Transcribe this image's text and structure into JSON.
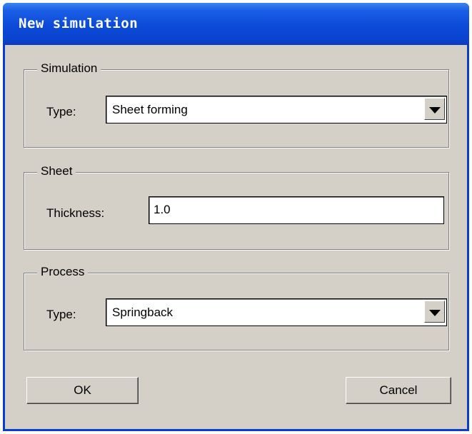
{
  "dialog": {
    "title": "New simulation"
  },
  "simulation_group": {
    "legend": "Simulation",
    "type_label": "Type:",
    "type_value": "Sheet forming"
  },
  "sheet_group": {
    "legend": "Sheet",
    "thickness_label": "Thickness:",
    "thickness_value": "1.0"
  },
  "process_group": {
    "legend": "Process",
    "type_label": "Type:",
    "type_value": "Springback"
  },
  "buttons": {
    "ok": "OK",
    "cancel": "Cancel"
  }
}
